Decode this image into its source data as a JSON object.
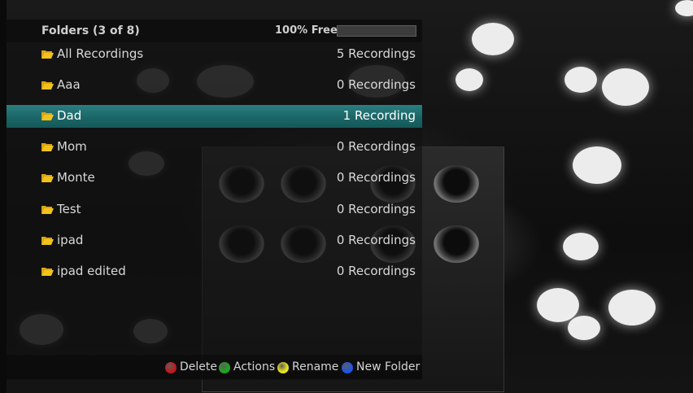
{
  "header": {
    "title": "Folders (3 of 8)",
    "free_label": "100% Free",
    "free_fraction": 1.0
  },
  "folders": [
    {
      "name": "All Recordings",
      "count": "5 Recordings"
    },
    {
      "name": "Aaa",
      "count": "0 Recordings"
    },
    {
      "name": "Dad",
      "count": "1 Recording",
      "selected": true
    },
    {
      "name": "Mom",
      "count": "0 Recordings"
    },
    {
      "name": "Monte",
      "count": "0 Recordings"
    },
    {
      "name": "Test",
      "count": "0 Recordings"
    },
    {
      "name": "ipad",
      "count": "0 Recordings"
    },
    {
      "name": "ipad edited",
      "count": "0 Recordings"
    }
  ],
  "footer": {
    "actions": [
      {
        "label": "Delete",
        "color": "#c0191b",
        "icon": "red-button-icon"
      },
      {
        "label": "Actions",
        "color": "#1ea51e",
        "icon": "green-button-icon"
      },
      {
        "label": "Rename",
        "color": "#e8e21a",
        "icon": "yellow-button-icon"
      },
      {
        "label": "New Folder",
        "color": "#1f54e6",
        "icon": "blue-button-icon"
      }
    ]
  },
  "colors": {
    "selected_row": "#1f6f70",
    "folder_icon": "#f2c21b"
  }
}
